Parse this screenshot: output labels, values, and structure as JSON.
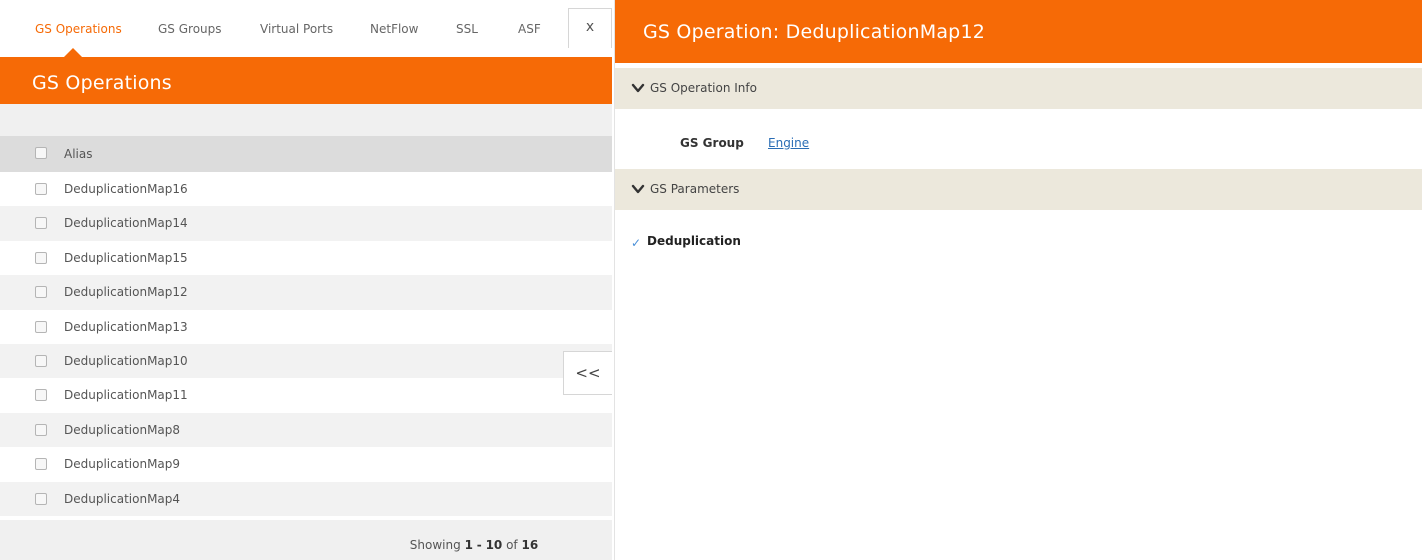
{
  "tabs": [
    {
      "label": "GS Operations",
      "active": true
    },
    {
      "label": "GS Groups",
      "active": false
    },
    {
      "label": "Virtual Ports",
      "active": false
    },
    {
      "label": "NetFlow",
      "active": false
    },
    {
      "label": "SSL",
      "active": false
    },
    {
      "label": "ASF",
      "active": false
    }
  ],
  "close_label": "x",
  "left_panel": {
    "title": "GS Operations",
    "column_header": "Alias",
    "rows": [
      "DeduplicationMap16",
      "DeduplicationMap14",
      "DeduplicationMap15",
      "DeduplicationMap12",
      "DeduplicationMap13",
      "DeduplicationMap10",
      "DeduplicationMap11",
      "DeduplicationMap8",
      "DeduplicationMap9",
      "DeduplicationMap4"
    ],
    "footer": {
      "prefix": "Showing",
      "start": "1",
      "sep": "-",
      "end": "10",
      "of": "of",
      "total": "16"
    },
    "collapse_label": "<<"
  },
  "right_panel": {
    "title": "GS Operation: DeduplicationMap12",
    "sections": [
      {
        "label": "GS Operation Info"
      },
      {
        "label": "GS Parameters"
      }
    ],
    "gs_group_label": "GS Group",
    "gs_group_value": "Engine",
    "check_mark": "✓",
    "param_label": "Deduplication"
  },
  "colors": {
    "accent": "#f66a06",
    "section_bg": "#ece8dc",
    "link": "#2a6db5"
  }
}
